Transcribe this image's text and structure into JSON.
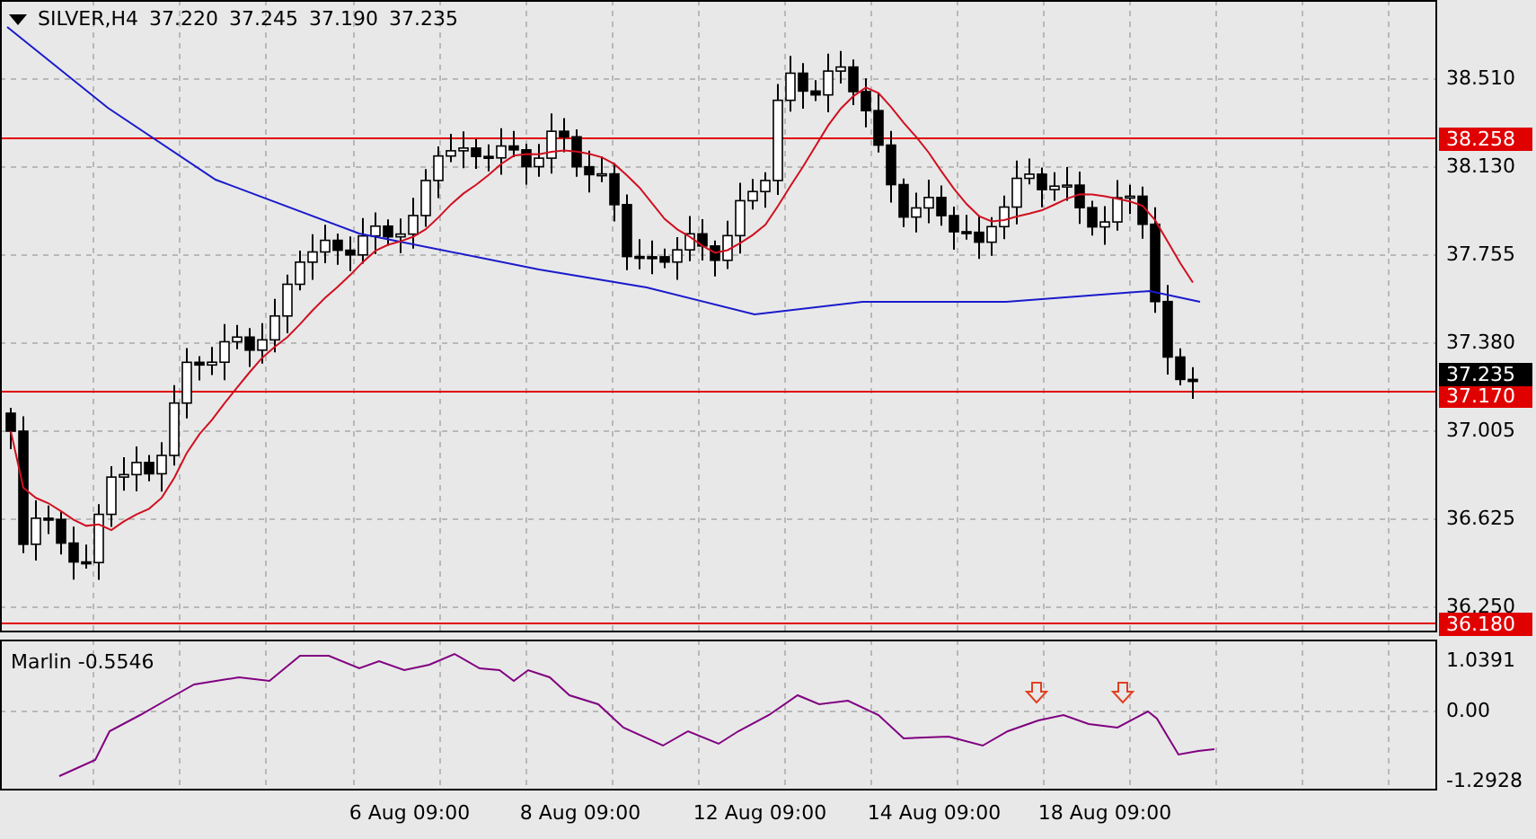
{
  "header": {
    "symbol": "SILVER,H4",
    "ohlc": [
      "37.220",
      "37.245",
      "37.190",
      "37.235"
    ]
  },
  "price_axis": {
    "ticks": [
      "38.510",
      "38.130",
      "37.755",
      "37.380",
      "37.005",
      "36.625",
      "36.250"
    ]
  },
  "levels": [
    {
      "label": "38.258"
    },
    {
      "label": "37.170"
    },
    {
      "label": "36.180"
    }
  ],
  "current_price": "37.235",
  "indicator": {
    "name": "Marlin",
    "value": "-0.5546",
    "ticks": [
      "1.0391",
      "0.00",
      "-1.2928"
    ]
  },
  "time_axis": {
    "labels": [
      "6 Aug 09:00",
      "8 Aug 09:00",
      "12 Aug 09:00",
      "14 Aug 09:00",
      "18 Aug 09:00"
    ]
  }
}
